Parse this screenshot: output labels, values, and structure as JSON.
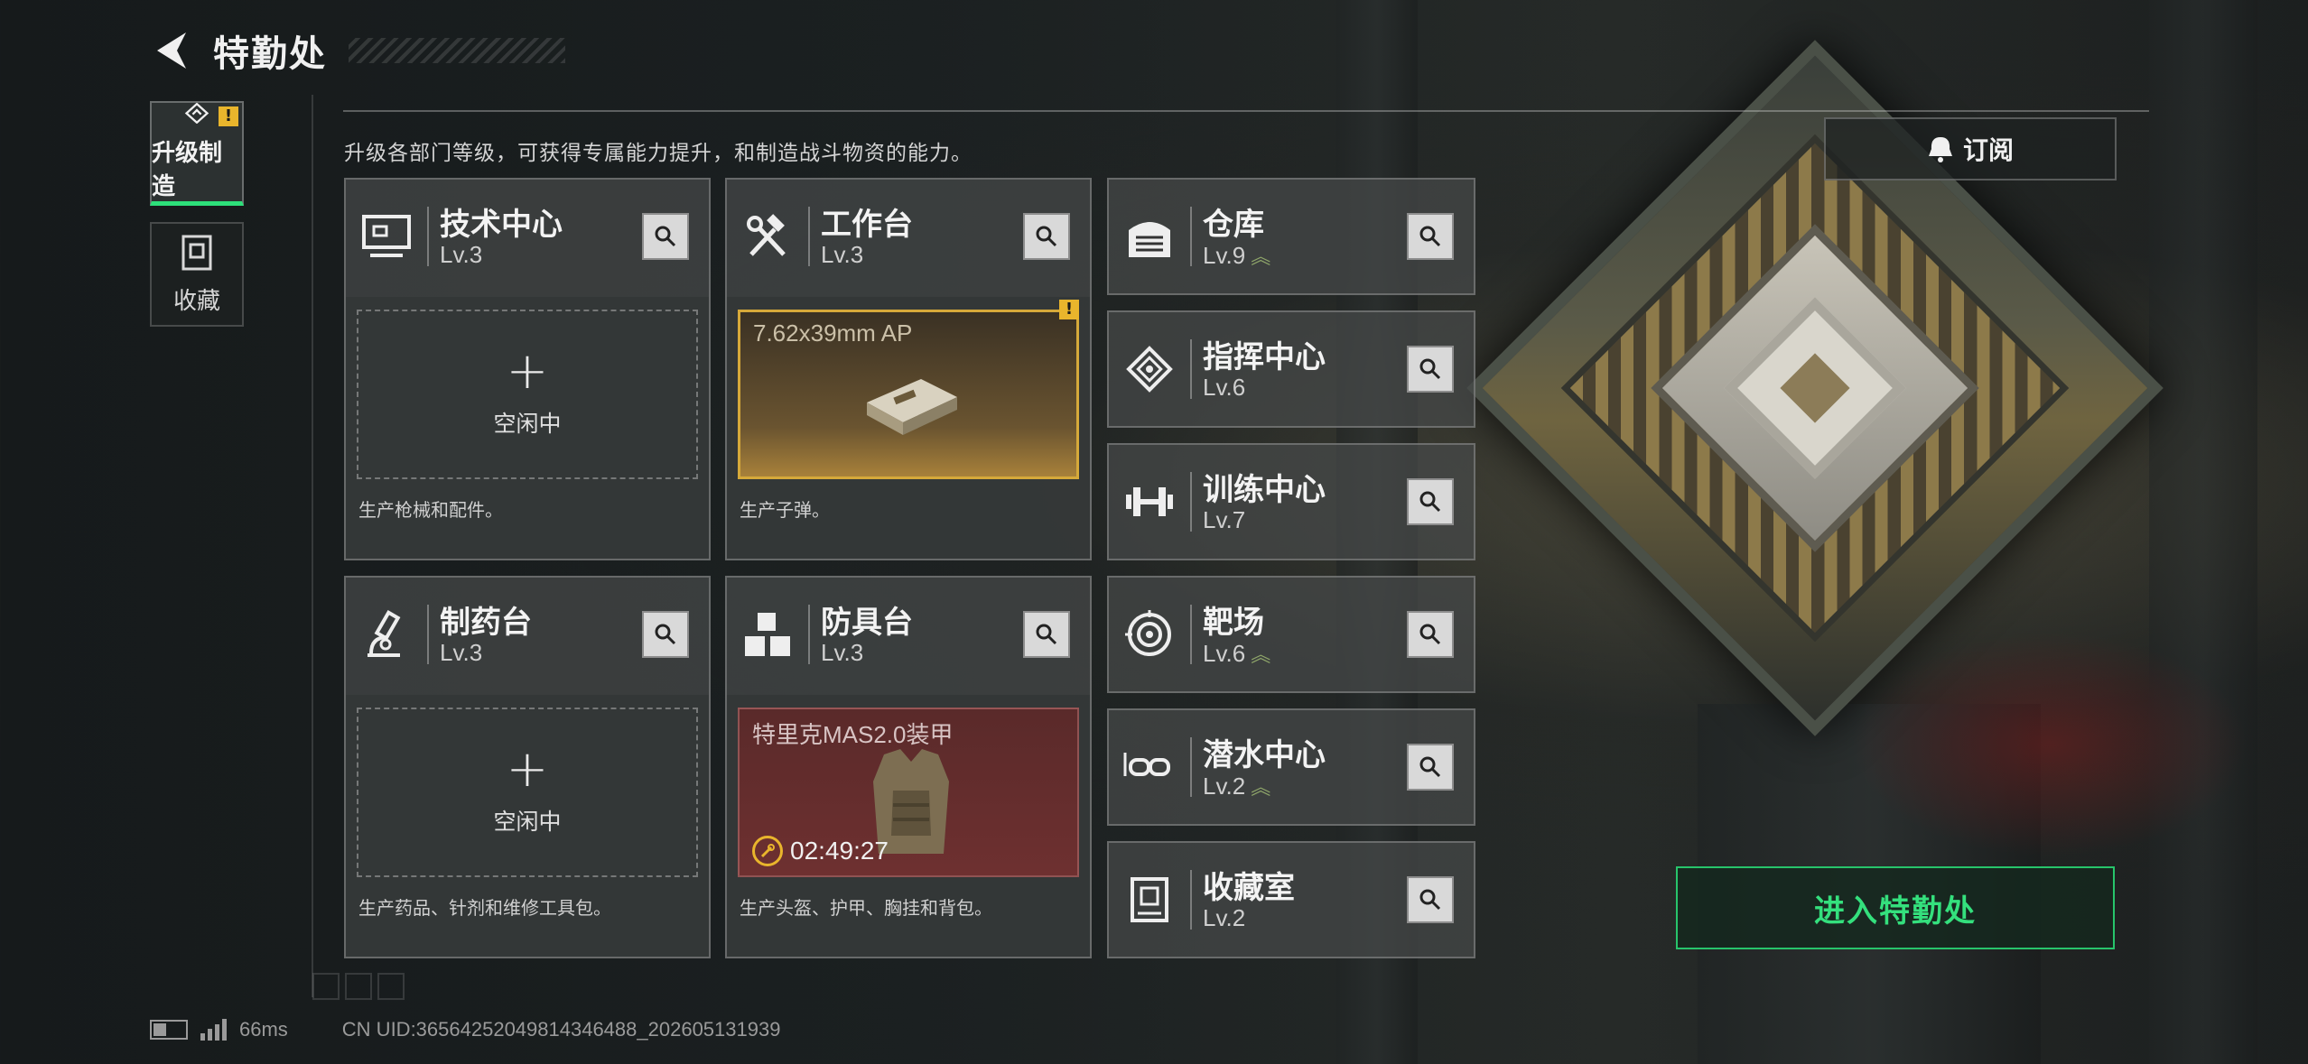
{
  "header": {
    "title": "特勤处"
  },
  "nav": {
    "upgrade_label": "升级制造",
    "upgrade_badge": "!",
    "collect_label": "收藏"
  },
  "description": "升级各部门等级，可获得专属能力提升，和制造战斗物资的能力。",
  "cards": {
    "tech": {
      "name": "技术中心",
      "level": "Lv.3",
      "slot_text": "空闲中",
      "slot_desc": "生产枪械和配件。"
    },
    "workbench": {
      "name": "工作台",
      "level": "Lv.3",
      "product": "7.62x39mm AP",
      "badge": "!",
      "slot_desc": "生产子弹。"
    },
    "pharmacy": {
      "name": "制药台",
      "level": "Lv.3",
      "slot_text": "空闲中",
      "slot_desc": "生产药品、针剂和维修工具包。"
    },
    "armor": {
      "name": "防具台",
      "level": "Lv.3",
      "product": "特里克MAS2.0装甲",
      "timer": "02:49:27",
      "slot_desc": "生产头盔、护甲、胸挂和背包。"
    }
  },
  "small_cards": [
    {
      "name": "仓库",
      "level": "Lv.9",
      "upgradable": true
    },
    {
      "name": "指挥中心",
      "level": "Lv.6",
      "upgradable": false
    },
    {
      "name": "训练中心",
      "level": "Lv.7",
      "upgradable": false
    },
    {
      "name": "靶场",
      "level": "Lv.6",
      "upgradable": true
    },
    {
      "name": "潜水中心",
      "level": "Lv.2",
      "upgradable": true
    },
    {
      "name": "收藏室",
      "level": "Lv.2",
      "upgradable": false
    }
  ],
  "upgrade_arrow": "︽",
  "subscribe_label": "订阅",
  "enter_label": "进入特勤处",
  "status": {
    "ping": "66ms",
    "uid": "CN UID:3656425204981434​6488_202605131939"
  },
  "colors": {
    "accent_green": "#34e07d",
    "badge_yellow": "#e9b52c",
    "upgrade_green": "#8fa66a"
  }
}
